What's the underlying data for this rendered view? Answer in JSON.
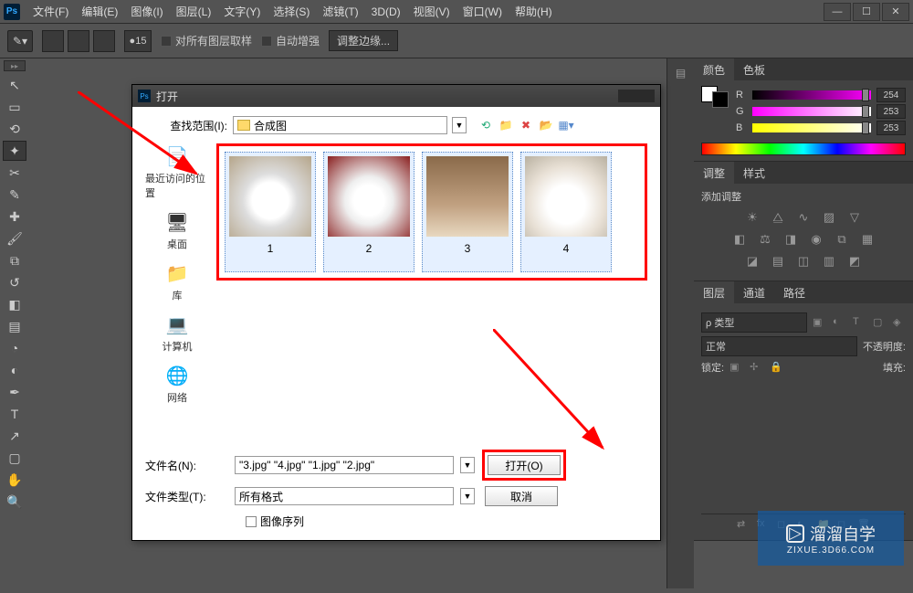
{
  "app": {
    "logo": "Ps"
  },
  "menu": [
    "文件(F)",
    "编辑(E)",
    "图像(I)",
    "图层(L)",
    "文字(Y)",
    "选择(S)",
    "滤镜(T)",
    "3D(D)",
    "视图(V)",
    "窗口(W)",
    "帮助(H)"
  ],
  "options": {
    "num_value": "15",
    "sample_all": "对所有图层取样",
    "auto_enhance": "自动增强",
    "refine_edge": "调整边缘..."
  },
  "window_controls": {
    "min": "—",
    "max": "☐",
    "close": "✕"
  },
  "panels": {
    "color": {
      "tabs": [
        "颜色",
        "色板"
      ],
      "r": {
        "label": "R",
        "value": "254"
      },
      "g": {
        "label": "G",
        "value": "253"
      },
      "b": {
        "label": "B",
        "value": "253"
      }
    },
    "adjust": {
      "tabs": [
        "调整",
        "样式"
      ],
      "heading": "添加调整"
    },
    "layers": {
      "tabs": [
        "图层",
        "通道",
        "路径"
      ],
      "kind": "ρ 类型",
      "blend": "正常",
      "opacity_label": "不透明度:",
      "lock_label": "锁定:",
      "fill_label": "填充:"
    }
  },
  "dialog": {
    "title": "打开",
    "look_label": "查找范围(I):",
    "look_value": "合成图",
    "sidebar": [
      {
        "label": "最近访问的位置",
        "icon": "📄"
      },
      {
        "label": "桌面",
        "icon": "🖥"
      },
      {
        "label": "库",
        "icon": "📁"
      },
      {
        "label": "计算机",
        "icon": "💻"
      },
      {
        "label": "网络",
        "icon": "🌐"
      }
    ],
    "thumbs": [
      {
        "label": "1",
        "selected": true
      },
      {
        "label": "2",
        "selected": true
      },
      {
        "label": "3",
        "selected": true
      },
      {
        "label": "4",
        "selected": true
      }
    ],
    "filename_label": "文件名(N):",
    "filename_value": "\"3.jpg\" \"4.jpg\" \"1.jpg\" \"2.jpg\"",
    "filetype_label": "文件类型(T):",
    "filetype_value": "所有格式",
    "open_btn": "打开(O)",
    "cancel_btn": "取消",
    "image_seq": "图像序列"
  },
  "watermark": {
    "brand": "溜溜自学",
    "sub": "ZIXUE.3D66.COM"
  }
}
